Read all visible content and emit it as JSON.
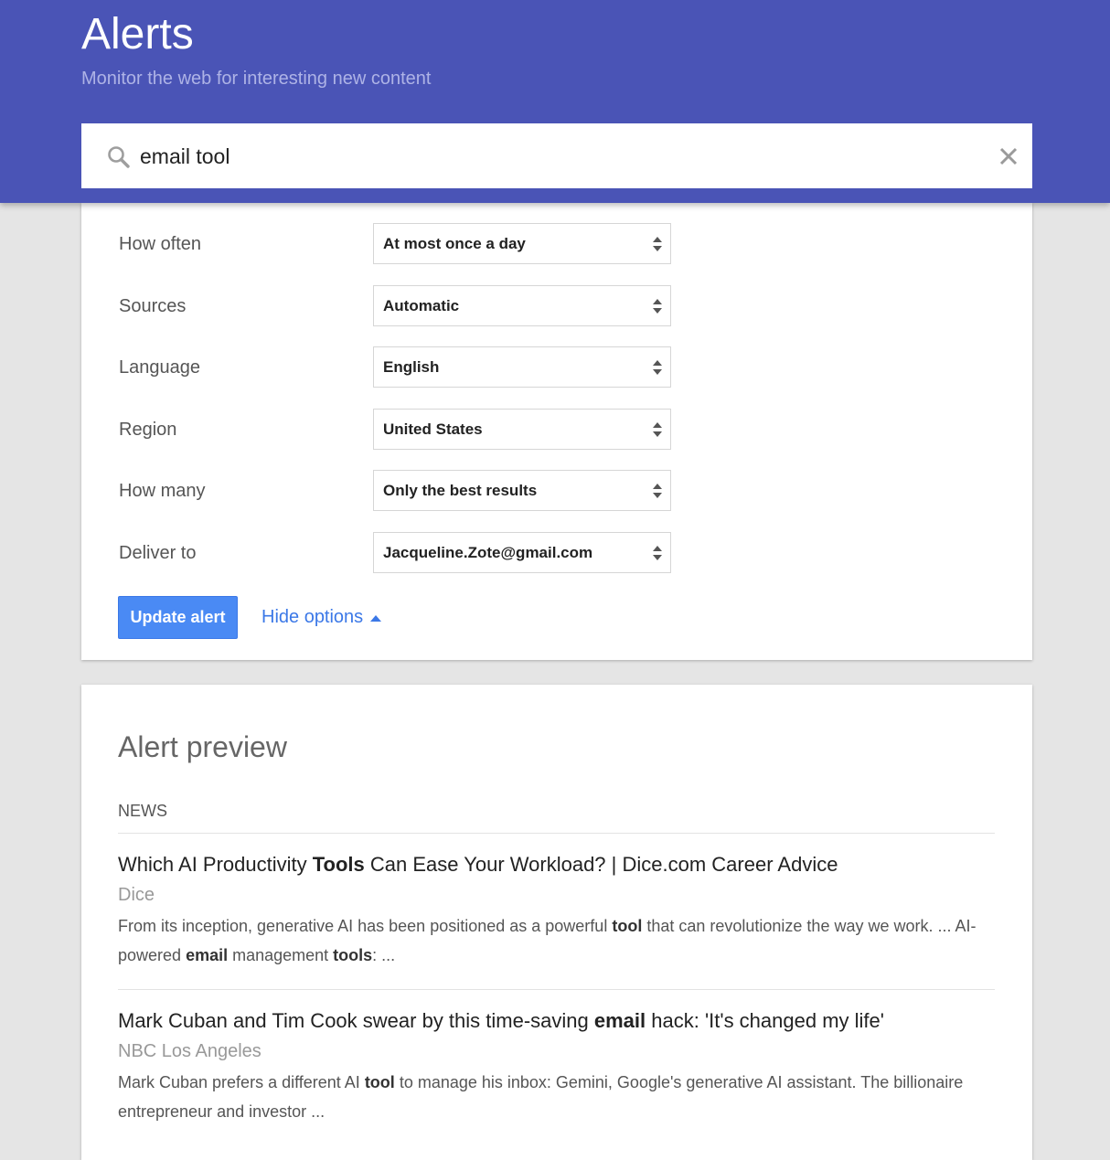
{
  "header": {
    "title": "Alerts",
    "subtitle": "Monitor the web for interesting new content"
  },
  "search": {
    "query": "email tool"
  },
  "options": [
    {
      "label": "How often",
      "value": "At most once a day"
    },
    {
      "label": "Sources",
      "value": "Automatic"
    },
    {
      "label": "Language",
      "value": "English"
    },
    {
      "label": "Region",
      "value": "United States"
    },
    {
      "label": "How many",
      "value": "Only the best results"
    },
    {
      "label": "Deliver to",
      "value": "Jacqueline.Zote@gmail.com"
    }
  ],
  "actions": {
    "update_label": "Update alert",
    "hide_options_label": "Hide options"
  },
  "preview": {
    "title": "Alert preview",
    "section": "NEWS",
    "results": [
      {
        "title": [
          {
            "t": "Which AI Productivity ",
            "b": false
          },
          {
            "t": "Tools",
            "b": true
          },
          {
            "t": " Can Ease Your Workload? | Dice.com Career Advice",
            "b": false
          }
        ],
        "source": "Dice",
        "snippet": [
          {
            "t": "From its inception, generative AI has been positioned as a powerful ",
            "b": false
          },
          {
            "t": "tool",
            "b": true
          },
          {
            "t": " that can revolutionize the way we work. ... AI-powered ",
            "b": false
          },
          {
            "t": "email",
            "b": true
          },
          {
            "t": " management ",
            "b": false
          },
          {
            "t": "tools",
            "b": true
          },
          {
            "t": ": ...",
            "b": false
          }
        ]
      },
      {
        "title": [
          {
            "t": "Mark Cuban and Tim Cook swear by this time-saving ",
            "b": false
          },
          {
            "t": "email",
            "b": true
          },
          {
            "t": " hack: 'It's changed my life'",
            "b": false
          }
        ],
        "source": "NBC Los Angeles",
        "snippet": [
          {
            "t": "Mark Cuban prefers a different AI ",
            "b": false
          },
          {
            "t": "tool",
            "b": true
          },
          {
            "t": " to manage his inbox: Gemini, Google's generative AI assistant. The billionaire entrepreneur and investor ...",
            "b": false
          }
        ]
      }
    ]
  },
  "colors": {
    "header_bg": "#4a54b6",
    "accent_blue": "#4a8af4",
    "link_blue": "#3b78e7",
    "page_bg": "#e5e5e5"
  },
  "icons": [
    "search-icon",
    "close-icon",
    "select-arrows-icon",
    "caret-up-icon"
  ]
}
